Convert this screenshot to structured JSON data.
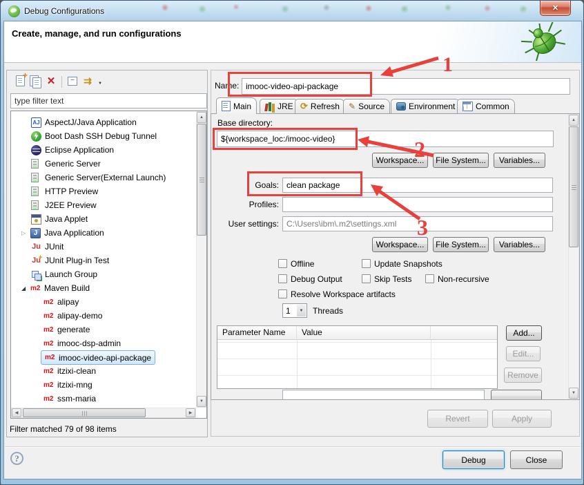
{
  "window": {
    "title": "Debug Configurations"
  },
  "header": {
    "title": "Create, manage, and run configurations"
  },
  "icons": {
    "aj": "AJ",
    "java_j": "J",
    "junit": "Ju",
    "m2": "m2",
    "plus": "+",
    "delete": "✕",
    "minus": "−",
    "filter_arrows": "⇉",
    "caret": "▼",
    "refresh": "⟳",
    "pencil": "✎",
    "help": "?",
    "close": "✕",
    "arrow_up": "▲",
    "arrow_down": "▼",
    "arrow_left": "◀",
    "arrow_right": "▶",
    "twisty_collapsed": "▷",
    "twisty_expanded": "◢"
  },
  "left_panel": {
    "toolbar": [
      "new-configuration",
      "duplicate-configuration",
      "delete-configuration",
      "collapse-all",
      "filter-launch-configurations"
    ],
    "filter_text": "type filter text",
    "status": "Filter matched 79 of 98 items",
    "tree": [
      {
        "label": "AspectJ/Java Application",
        "icon": "aspectj-icon"
      },
      {
        "label": "Boot Dash SSH Debug Tunnel",
        "icon": "boot-dash-icon"
      },
      {
        "label": "Eclipse Application",
        "icon": "eclipse-icon"
      },
      {
        "label": "Generic Server",
        "icon": "server-icon"
      },
      {
        "label": "Generic Server(External Launch)",
        "icon": "server-icon"
      },
      {
        "label": "HTTP Preview",
        "icon": "server-icon"
      },
      {
        "label": "J2EE Preview",
        "icon": "server-icon"
      },
      {
        "label": "Java Applet",
        "icon": "applet-icon"
      },
      {
        "label": "Java Application",
        "icon": "java-icon",
        "collapsed": true
      },
      {
        "label": "JUnit",
        "icon": "junit-icon"
      },
      {
        "label": "JUnit Plug-in Test",
        "icon": "junit-plugin-icon"
      },
      {
        "label": "Launch Group",
        "icon": "launch-group-icon"
      },
      {
        "label": "Maven Build",
        "icon": "maven-icon",
        "expanded": true
      },
      {
        "label": "alipay",
        "icon": "maven-icon",
        "child": true
      },
      {
        "label": "alipay-demo",
        "icon": "maven-icon",
        "child": true
      },
      {
        "label": "generate",
        "icon": "maven-icon",
        "child": true
      },
      {
        "label": "imooc-dsp-admin",
        "icon": "maven-icon",
        "child": true
      },
      {
        "label": "imooc-video-api-package",
        "icon": "maven-icon",
        "child": true,
        "selected": true
      },
      {
        "label": "itzixi-clean",
        "icon": "maven-icon",
        "child": true
      },
      {
        "label": "itzixi-mng",
        "icon": "maven-icon",
        "child": true
      },
      {
        "label": "ssm-maria",
        "icon": "maven-icon",
        "child": true
      }
    ]
  },
  "right_panel": {
    "name_label": "Name:",
    "name_value": "imooc-video-api-package",
    "tabs": [
      {
        "label": "Main",
        "icon": "main-tab-icon",
        "active": true
      },
      {
        "label": "JRE",
        "icon": "jre-tab-icon"
      },
      {
        "label": "Refresh",
        "icon": "refresh-tab-icon"
      },
      {
        "label": "Source",
        "icon": "source-tab-icon"
      },
      {
        "label": "Environment",
        "icon": "environment-tab-icon"
      },
      {
        "label": "Common",
        "icon": "common-tab-icon"
      }
    ],
    "revert_label": "Revert",
    "apply_label": "Apply"
  },
  "main_tab": {
    "base_directory_label": "Base directory:",
    "base_directory_value": "${workspace_loc:/imooc-video}",
    "path_buttons": [
      "Workspace...",
      "File System...",
      "Variables..."
    ],
    "goals_label": "Goals:",
    "goals_value": "clean package",
    "profiles_label": "Profiles:",
    "profiles_value": "",
    "user_settings_label": "User settings:",
    "user_settings_value": "C:\\Users\\ibm\\.m2\\settings.xml",
    "checkboxes": [
      "Offline",
      "Update Snapshots",
      "Debug Output",
      "Skip Tests",
      "Non-recursive",
      "Resolve Workspace artifacts"
    ],
    "threads_value": "1",
    "threads_label": "Threads",
    "table_columns": [
      "Parameter Name",
      "Value"
    ],
    "table_buttons": [
      "Add...",
      "Edit...",
      "Remove"
    ]
  },
  "footer": {
    "debug_label": "Debug",
    "close_label": "Close"
  },
  "annotations": {
    "color": "#e8403c",
    "labels": [
      "1",
      "2",
      "3"
    ]
  }
}
